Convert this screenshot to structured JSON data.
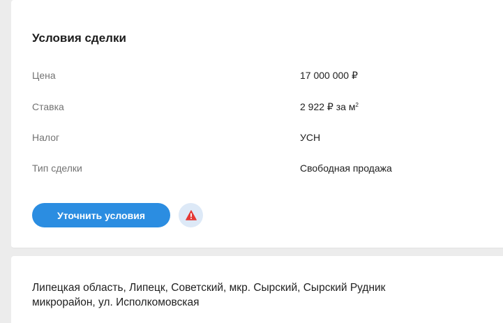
{
  "terms": {
    "title": "Условия сделки",
    "rows": [
      {
        "label": "Цена",
        "value": "17 000 000 ₽"
      },
      {
        "label": "Ставка",
        "value": "2 922 ₽ за м",
        "unit_sup": "2"
      },
      {
        "label": "Налог",
        "value": "УСН"
      },
      {
        "label": "Тип сделки",
        "value": "Свободная продажа"
      }
    ],
    "clarify_button_label": "Уточнить условия",
    "warning_icon": "warning-triangle-icon",
    "colors": {
      "primary_button": "#2b8de1",
      "warning_badge_bg": "#dde9f7",
      "warning_icon": "#e53935"
    }
  },
  "address": {
    "line1": "Липецкая область, Липецк, Советский, мкр. Сырский, Сырский Рудник",
    "line2": "микрорайон, ул. Исполкомовская"
  }
}
